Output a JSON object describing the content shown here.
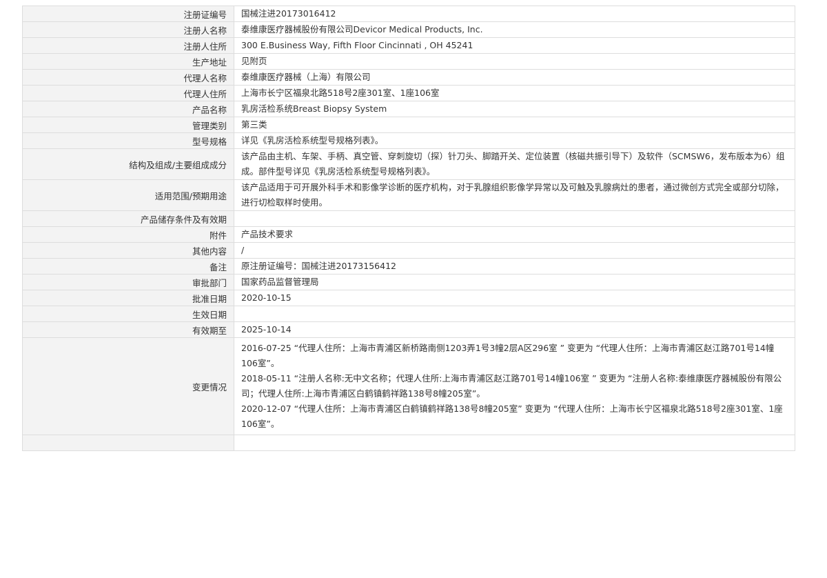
{
  "rows": [
    {
      "label": "注册证编号",
      "value": "国械注进20173016412"
    },
    {
      "label": "注册人名称",
      "value": "泰维康医疗器械股份有限公司Devicor Medical Products, Inc."
    },
    {
      "label": "注册人住所",
      "value": "300 E.Business Way, Fifth Floor Cincinnati , OH 45241"
    },
    {
      "label": "生产地址",
      "value": "见附页"
    },
    {
      "label": "代理人名称",
      "value": "泰维康医疗器械（上海）有限公司"
    },
    {
      "label": "代理人住所",
      "value": "上海市长宁区福泉北路518号2座301室、1座106室"
    },
    {
      "label": "产品名称",
      "value": "乳房活检系统Breast Biopsy System"
    },
    {
      "label": "管理类别",
      "value": "第三类"
    },
    {
      "label": "型号规格",
      "value": "详见《乳房活检系统型号规格列表》。"
    },
    {
      "label": "结构及组成/主要组成成分",
      "value": "该产品由主机、车架、手柄、真空管、穿刺旋切（探）针刀头、脚踏开关、定位装置（核磁共振引导下）及软件（SCMSW6，发布版本为6）组成。部件型号详见《乳房活检系统型号规格列表》。"
    },
    {
      "label": "适用范围/预期用途",
      "value": "该产品适用于可开展外科手术和影像学诊断的医疗机构，对于乳腺组织影像学异常以及可触及乳腺病灶的患者，通过微创方式完全或部分切除，进行切检取样时使用。"
    },
    {
      "label": "产品储存条件及有效期",
      "value": ""
    },
    {
      "label": "附件",
      "value": "产品技术要求"
    },
    {
      "label": "其他内容",
      "value": "/"
    },
    {
      "label": "备注",
      "value": "原注册证编号：国械注进20173156412"
    },
    {
      "label": "审批部门",
      "value": "国家药品监督管理局"
    },
    {
      "label": "批准日期",
      "value": "2020-10-15"
    },
    {
      "label": "生效日期",
      "value": ""
    },
    {
      "label": "有效期至",
      "value": "2025-10-14"
    }
  ],
  "changes": {
    "label": "变更情况",
    "items": [
      "2016-07-25 “代理人住所：上海市青浦区新桥路南侧1203弄1号3幢2层A区296室 ” 变更为 “代理人住所：上海市青浦区赵江路701号14幢106室”。",
      "2018-05-11 “注册人名称:无中文名称；代理人住所:上海市青浦区赵江路701号14幢106室 ” 变更为 “注册人名称:泰维康医疗器械股份有限公司；代理人住所:上海市青浦区白鹤镇鹤祥路138号8幢205室”。",
      "2020-12-07 “代理人住所：上海市青浦区白鹤镇鹤祥路138号8幢205室” 变更为 “代理人住所：上海市长宁区福泉北路518号2座301室、1座106室”。"
    ]
  }
}
